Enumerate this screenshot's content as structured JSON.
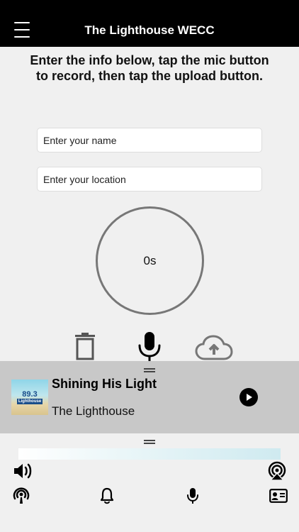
{
  "header": {
    "title": "The Lighthouse WECC",
    "menu_icon": "hamburger-menu-icon"
  },
  "instructions": "Enter the info below, tap the mic button to record, then tap the upload button.",
  "form": {
    "name_placeholder": "Enter your name",
    "location_placeholder": "Enter your location"
  },
  "timer": {
    "value": "0s"
  },
  "controls": {
    "delete_icon": "trash-icon",
    "record_icon": "microphone-icon",
    "upload_icon": "cloud-upload-icon"
  },
  "player": {
    "art_freq": "89.3",
    "art_brand": "Lighthouse",
    "song_title": "Shining His Light",
    "station": "The Lighthouse",
    "play_icon": "play-icon"
  },
  "bottom_icons": {
    "volume": "speaker-icon",
    "airplay": "airplay-icon"
  },
  "tabs": [
    {
      "icon": "podcast-icon"
    },
    {
      "icon": "bell-icon"
    },
    {
      "icon": "microphone-icon"
    },
    {
      "icon": "contact-card-icon"
    }
  ]
}
